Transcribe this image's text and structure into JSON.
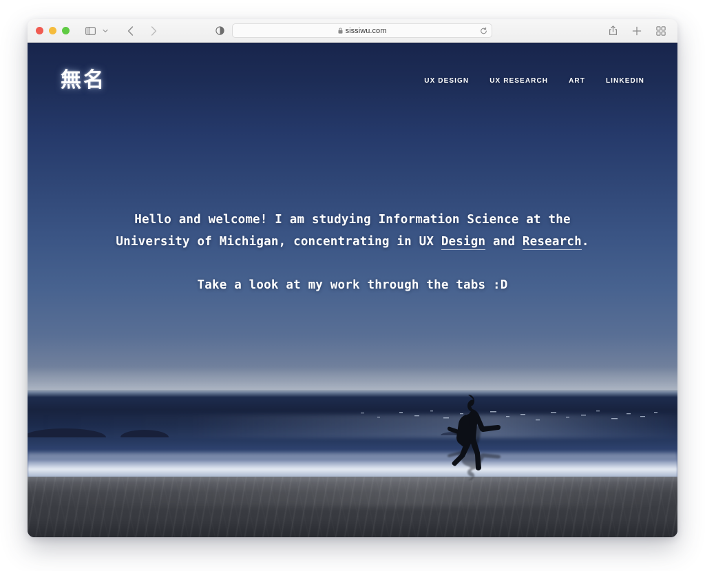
{
  "browser": {
    "traffic_lights": [
      "close",
      "minimize",
      "maximize"
    ],
    "sidebar_tooltip": "Sidebar",
    "back_label": "Back",
    "forward_label": "Forward",
    "reader_label": "Reader",
    "url": "sissiwu.com",
    "reload_label": "Reload",
    "share_label": "Share",
    "new_tab_label": "New Tab",
    "tab_overview_label": "Tab Overview",
    "colors": {
      "close": "#f05b51",
      "minimize": "#f5bc3d",
      "maximize": "#5fcb43",
      "toolbar_bg": "#f2f2f2",
      "url_bar_bg": "#fbfbfb"
    }
  },
  "site": {
    "logo": "無名",
    "nav": [
      {
        "label": "UX DESIGN"
      },
      {
        "label": "UX RESEARCH"
      },
      {
        "label": "ART"
      },
      {
        "label": "LINKEDIN"
      }
    ],
    "hero": {
      "line1_a": "Hello and welcome! I am studying Information Science at the University of Michigan, concentrating in UX ",
      "link_design": "Design",
      "line1_b": " and ",
      "link_research": "Research",
      "line1_c": ".",
      "line2": "Take a look at my work through the tabs :D"
    },
    "background": {
      "description": "beach-at-dusk-photo",
      "sky_top": "#18254c",
      "sky_horizon": "#8d99ab",
      "ocean": "#1c2b4d",
      "sand": "#3b3d43",
      "subject": "running-person-silhouette"
    }
  }
}
